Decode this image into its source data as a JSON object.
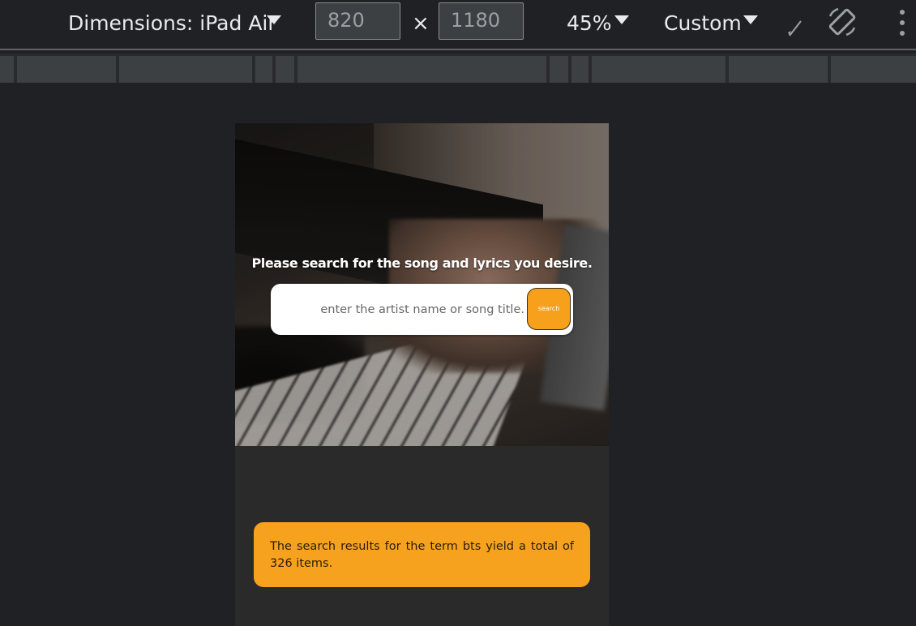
{
  "toolbar": {
    "dimensions_label": "Dimensions: iPad Air",
    "width_value": "820",
    "times_symbol": "×",
    "height_value": "1180",
    "zoom_label": "45%",
    "throttle_label": "Custom"
  },
  "page": {
    "hero_title": "Please search for the song and lyrics you desire.",
    "search_placeholder": "enter the artist name or song title.",
    "search_button_label": "search",
    "result_text": "The search results for the term bts yield a total of 326 items."
  },
  "colors": {
    "accent": "#f7a01c",
    "devtools_bg": "#202124",
    "page_bg": "#2a2a2a"
  }
}
